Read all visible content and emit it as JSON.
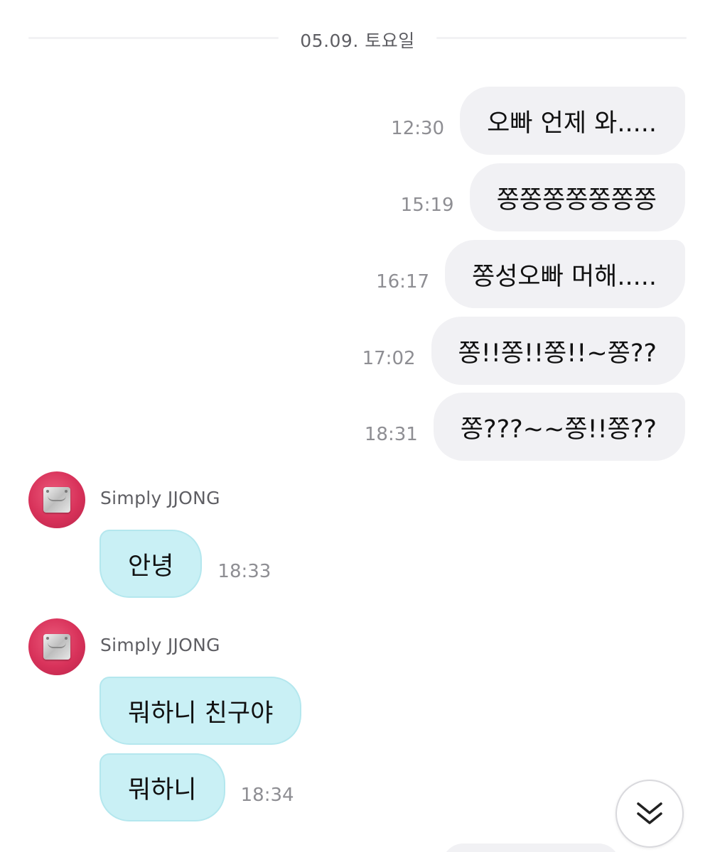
{
  "date_divider": "05.09. 토요일",
  "sent": [
    {
      "text": "오빠 언제 와.....",
      "time": "12:30"
    },
    {
      "text": "쫑쫑쫑쫑쫑쫑쫑",
      "time": "15:19"
    },
    {
      "text": "쫑성오빠 머해.....",
      "time": "16:17"
    },
    {
      "text": "쫑!!쫑!!쫑!!~쫑??",
      "time": "17:02"
    },
    {
      "text": "쫑???~~쫑!!쫑??",
      "time": "18:31"
    }
  ],
  "received_groups": [
    {
      "sender": "Simply JJONG",
      "messages": [
        {
          "text": "안녕",
          "time": "18:33"
        }
      ]
    },
    {
      "sender": "Simply JJONG",
      "messages": [
        {
          "text": "뭐하니 친구야",
          "time": ""
        },
        {
          "text": "뭐하니",
          "time": "18:34"
        }
      ]
    }
  ],
  "icons": {
    "scroll_down": "double-chevron-down-icon",
    "avatar": "guitar-neck-plate-avatar"
  },
  "colors": {
    "sent_bubble": "#f1f1f4",
    "received_bubble": "#c9f0f5",
    "avatar_bg": "#d8325a"
  }
}
